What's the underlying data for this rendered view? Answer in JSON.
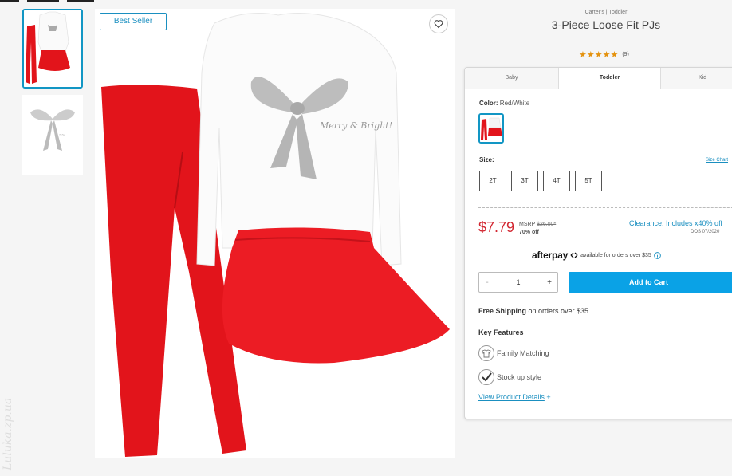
{
  "product": {
    "brand_line": "Carter's | Toddler",
    "title": "3-Piece Loose Fit PJs",
    "rating_stars": "★★★★★",
    "rating_value": 5,
    "review_count": "(9)",
    "badge": "Best Seller",
    "shirt_text": "Merry & Bright!",
    "watermark": "Luluka.zp.ua"
  },
  "gallery": {
    "thumbnails": [
      {
        "name": "outfit-thumbnail",
        "selected": true
      },
      {
        "name": "bow-print-thumbnail",
        "selected": false
      }
    ]
  },
  "tabs": [
    "Baby",
    "Toddler",
    "Kid"
  ],
  "active_tab": "Toddler",
  "color": {
    "label": "Color:",
    "value": "Red/White"
  },
  "size": {
    "label": "Size:",
    "chart_link": "Size Chart",
    "options": [
      "2T",
      "3T",
      "4T",
      "5T"
    ]
  },
  "pricing": {
    "price": "$7.79",
    "msrp_label": "MSRP",
    "msrp_value": "$26.00*",
    "discount": "70% off",
    "clearance": "Clearance: Includes x40% off",
    "dos": "DOS 07/2020"
  },
  "afterpay": {
    "logo": "afterpay",
    "note": "available for orders over $35"
  },
  "quantity": {
    "minus": "-",
    "value": "1",
    "plus": "+"
  },
  "cart_button": "Add to Cart",
  "shipping": {
    "bold": "Free Shipping",
    "rest": " on orders over $35"
  },
  "key_features": {
    "heading": "Key Features",
    "items": [
      {
        "icon": "family-matching-icon",
        "label": "Family Matching"
      },
      {
        "icon": "checkmark-icon",
        "label": "Stock up style"
      }
    ]
  },
  "details_link": {
    "label": "View Product Details",
    "plus": "+"
  },
  "colors": {
    "accent": "#1296c4",
    "price_red": "#d22630",
    "cart_blue": "#0aa2e6",
    "rating_orange": "#e4920e",
    "garment_red": "#e2141b"
  }
}
